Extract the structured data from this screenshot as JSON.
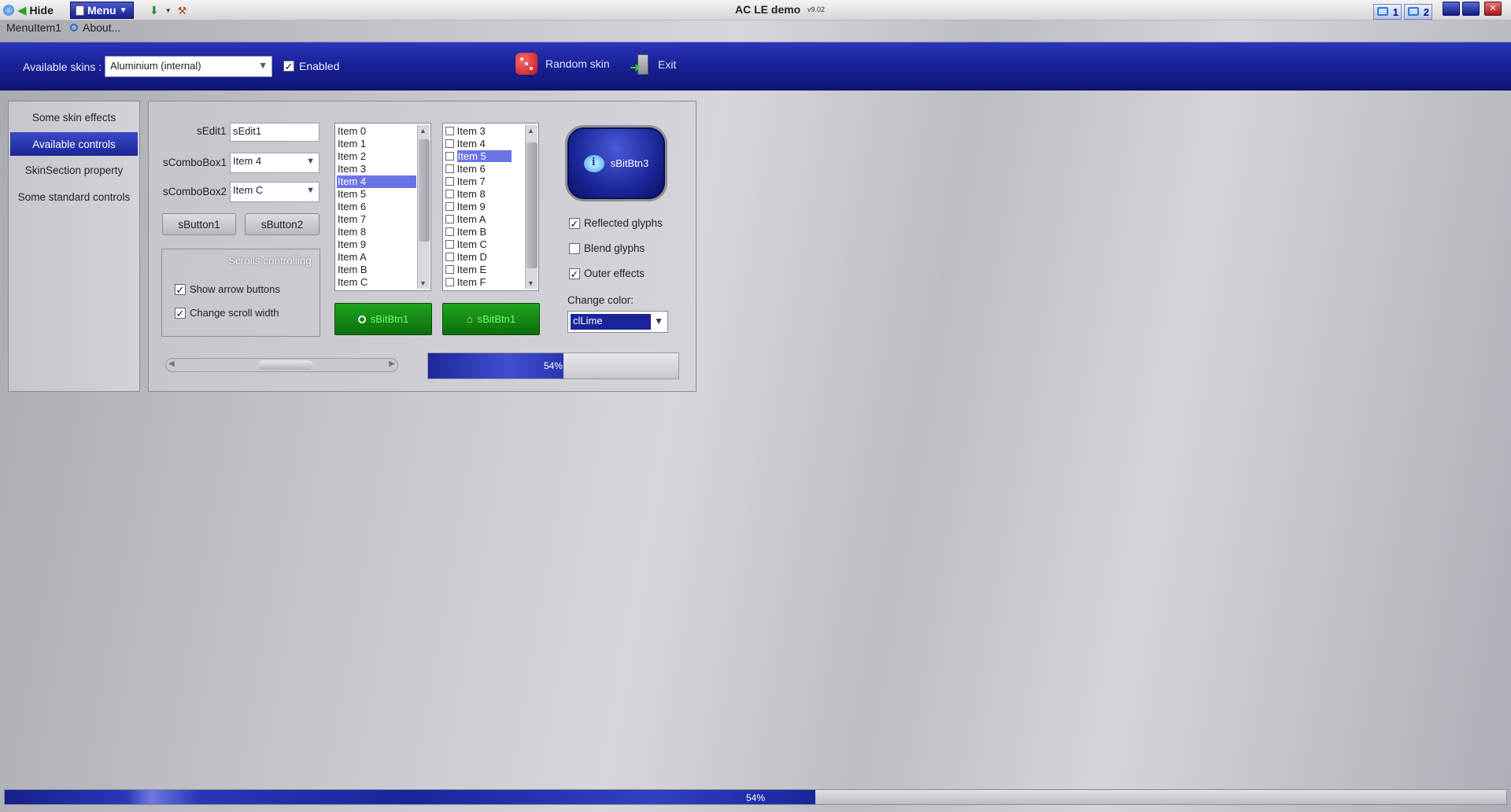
{
  "titlebar": {
    "hide_label": "Hide",
    "menu_label": "Menu",
    "title": "AC LE demo",
    "version": "v9.02",
    "monitors": [
      "1",
      "2"
    ]
  },
  "menubar": {
    "item1": "MenuItem1",
    "about": "About..."
  },
  "toolbar": {
    "skins_label": "Available skins :",
    "skin_value": "Aluminium (internal)",
    "enabled_label": "Enabled",
    "enabled_checked": true,
    "random_skin_label": "Random skin",
    "exit_label": "Exit"
  },
  "sidebar": {
    "items": [
      {
        "label": "Some skin effects",
        "active": false
      },
      {
        "label": "Available controls",
        "active": true
      },
      {
        "label": "SkinSection property",
        "active": false
      },
      {
        "label": "Some standard controls",
        "active": false
      }
    ]
  },
  "controls": {
    "sedit1_label": "sEdit1",
    "sedit1_value": "sEdit1",
    "scombo1_label": "sComboBox1",
    "scombo1_value": "Item 4",
    "scombo2_label": "sComboBox2",
    "scombo2_value": "Item C",
    "button1": "sButton1",
    "button2": "sButton2",
    "scrolls_title": "Scrolls controlling",
    "show_arrows_label": "Show arrow buttons",
    "show_arrows_checked": true,
    "change_width_label": "Change scroll width",
    "change_width_checked": true,
    "listbox1": [
      "Item 0",
      "Item 1",
      "Item 2",
      "Item 3",
      "Item 4",
      "Item 5",
      "Item 6",
      "Item 7",
      "Item 8",
      "Item 9",
      "Item A",
      "Item B",
      "Item C"
    ],
    "listbox1_selected": "Item 4",
    "checklist": [
      "Item 3",
      "Item 4",
      "Item 5",
      "Item 6",
      "Item 7",
      "Item 8",
      "Item 9",
      "Item A",
      "Item B",
      "Item C",
      "Item D",
      "Item E",
      "Item F"
    ],
    "checklist_selected": "Item 5",
    "bitbtn1_a": "sBitBtn1",
    "bitbtn1_b": "sBitBtn1",
    "bitbtn3": "sBitBtn3",
    "reflected_label": "Reflected glyphs",
    "reflected_checked": true,
    "blend_label": "Blend glyphs",
    "blend_checked": false,
    "outer_label": "Outer effects",
    "outer_checked": true,
    "change_color_label": "Change color:",
    "color_value": "clLime",
    "progress_text": "54%",
    "progress_value": 0.54
  },
  "statusbar": {
    "progress_text": "54%",
    "progress_value": 0.54
  },
  "colors": {
    "accent": "#1a2599",
    "selection": "#6b74e4",
    "green_button": "#1fa51f"
  }
}
